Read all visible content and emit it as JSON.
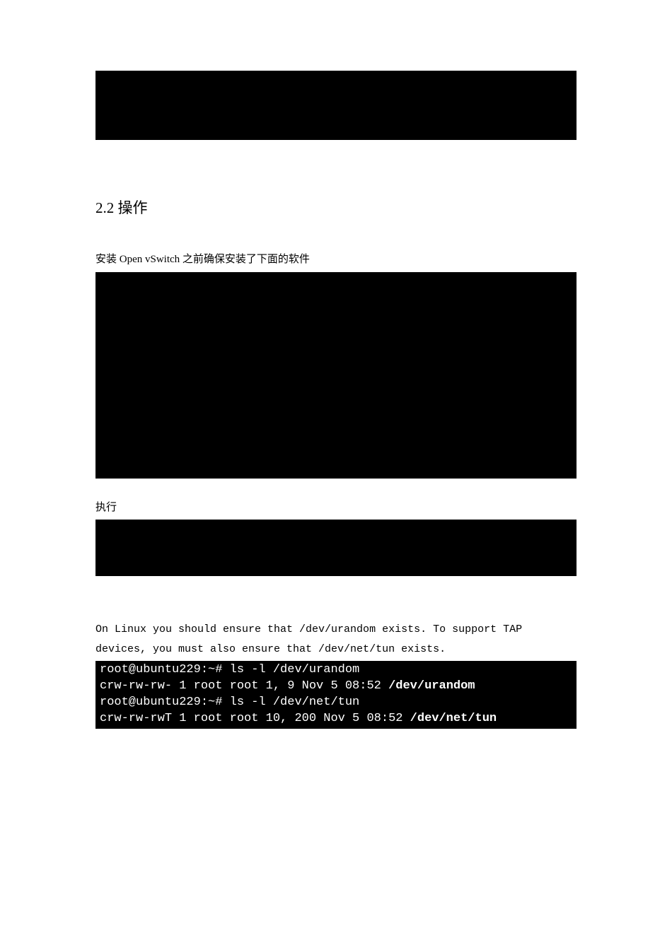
{
  "heading": "2.2 操作",
  "intro_text": "安装 Open vSwitch 之前确保安装了下面的软件",
  "exec_label": "执行",
  "linux_note_line1": "On Linux you should ensure that /dev/urandom exists.  To support TAP",
  "linux_note_line2": "devices, you must also ensure that /dev/net/tun exists.",
  "terminal": {
    "line1_prompt": "root@ubuntu229:~# ls -l /dev/urandom",
    "line2_prefix": "crw-rw-rw- 1 root root 1, 9 Nov  5 08:52 ",
    "line2_bold": "/dev/urandom",
    "line3_prompt": "root@ubuntu229:~# ls -l /dev/net/tun",
    "line4_prefix": "crw-rw-rwT 1 root root 10, 200 Nov  5 08:52 ",
    "line4_bold": "/dev/net/tun"
  }
}
